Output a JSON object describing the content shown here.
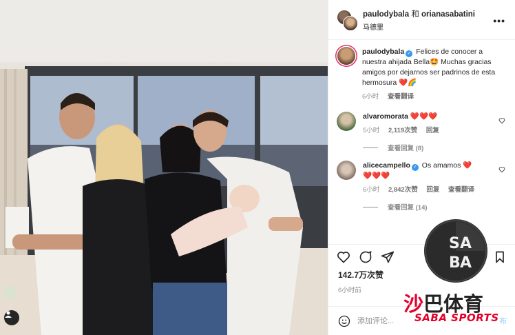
{
  "post": {
    "author_primary": "paulodybala",
    "conjunction": "和",
    "author_secondary": "orianasabatini",
    "location": "马德里",
    "more_icon": "more-horizontal-icon"
  },
  "caption": {
    "username": "paulodybala",
    "text": "Felices de conocer a nuestra ahijada Bella🤩 Muchas gracias amigos por dejarnos ser padrinos de esta hermosura",
    "emoji_tail": "❤️🌈",
    "time": "6小时",
    "translate": "查看翻译"
  },
  "comments": [
    {
      "username": "alvaromorata",
      "text": "❤️❤️❤️",
      "time": "5小时",
      "likes": "2,119次赞",
      "reply": "回复",
      "replies_label": "查看回复 (8)"
    },
    {
      "username": "alicecampello",
      "text": "Os amamos ❤️",
      "text2": "❤️❤️❤️",
      "time": "6小时",
      "likes": "2,842次赞",
      "reply": "回复",
      "translate": "查看翻译",
      "replies_label": "查看回复 (14)"
    }
  ],
  "stats": {
    "likes": "142.7万次赞",
    "posted_ago": "6小时前"
  },
  "composer": {
    "placeholder": "添加评论...",
    "post_label": "布"
  },
  "watermark": {
    "logo_letters": "SABA",
    "cn_red": "沙",
    "cn_black": "巴体育",
    "en": "SABA SPORTS"
  },
  "colors": {
    "accent_blue": "#3897f0",
    "heart_red": "#ed4956",
    "watermark_red": "#e4002b"
  }
}
